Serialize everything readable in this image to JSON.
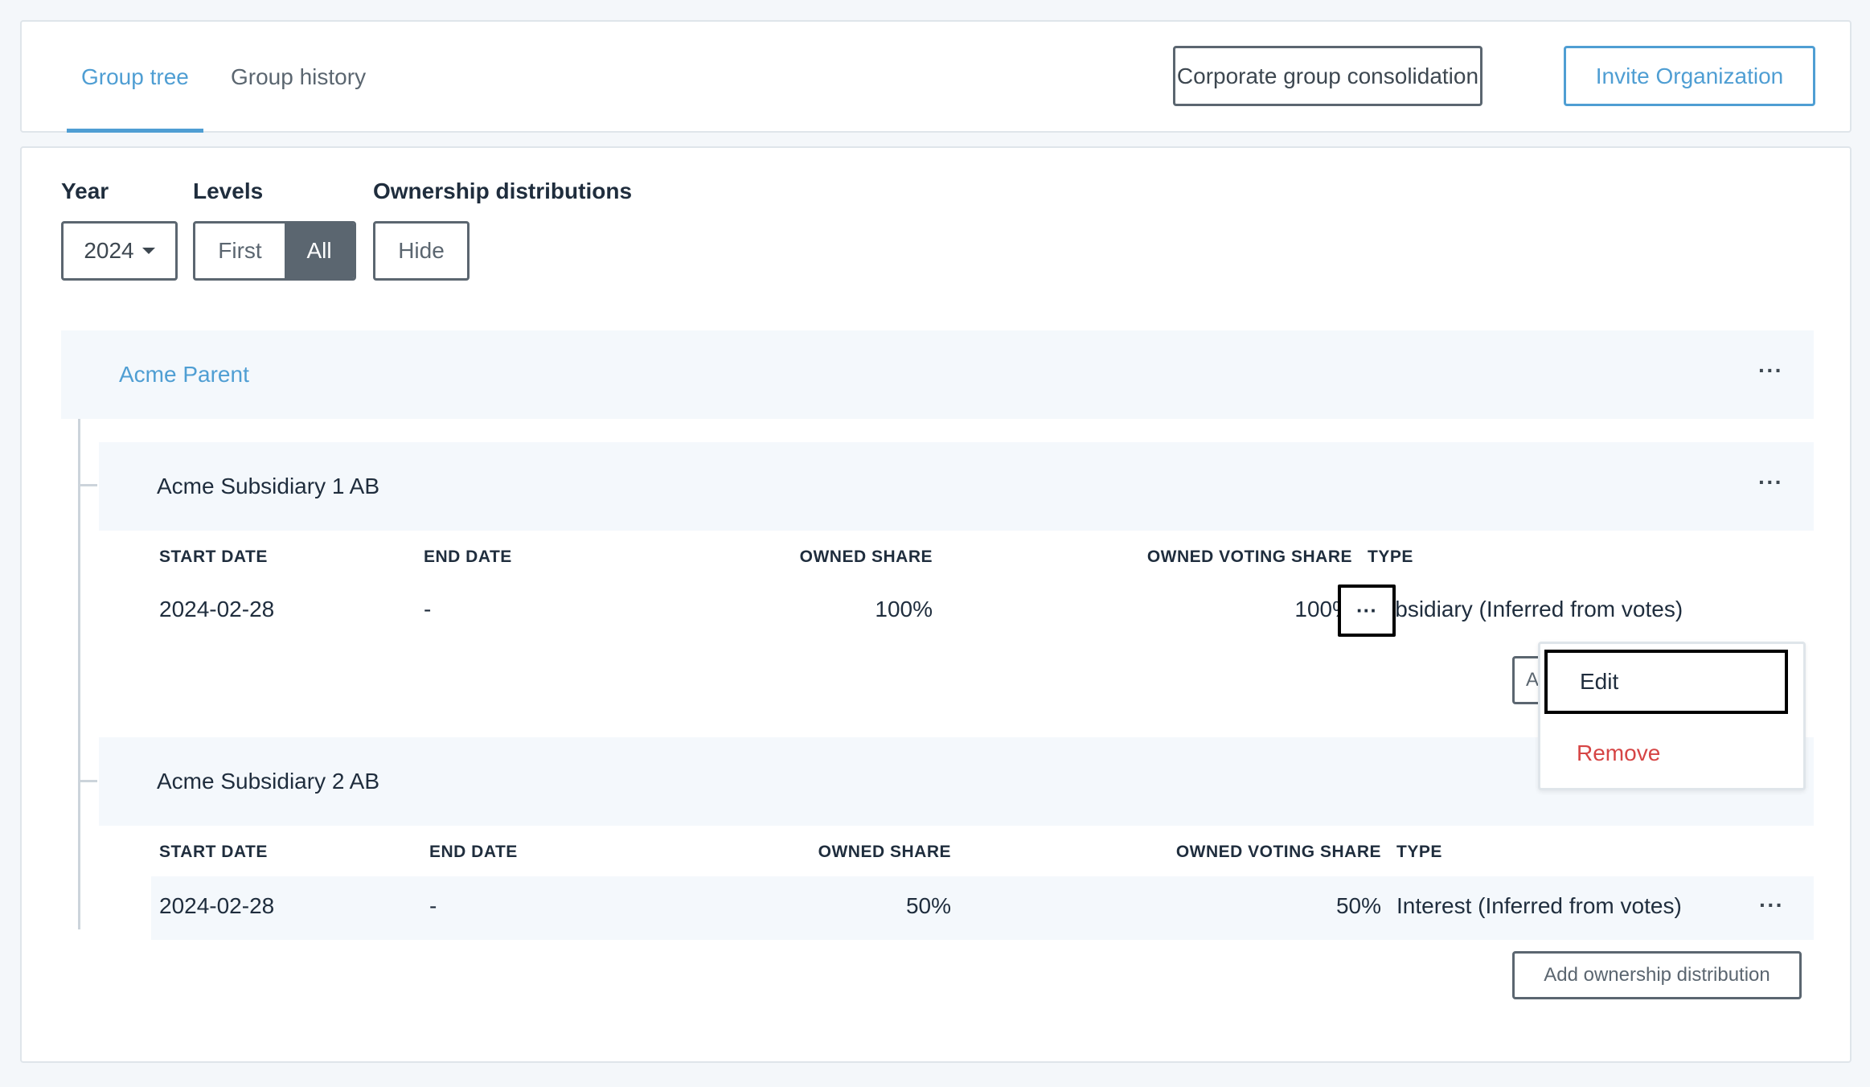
{
  "tabs": {
    "group_tree": "Group tree",
    "group_history": "Group history"
  },
  "header_buttons": {
    "consolidation": "Corporate group consolidation",
    "invite": "Invite Organization"
  },
  "filters": {
    "year_label": "Year",
    "year_value": "2024",
    "levels_label": "Levels",
    "levels_first": "First",
    "levels_all": "All",
    "levels_selected": "All",
    "ownership_label": "Ownership distributions",
    "ownership_toggle": "Hide"
  },
  "tree": {
    "parent": {
      "name": "Acme Parent",
      "menu": "···"
    },
    "columns": {
      "start": "START DATE",
      "end": "END DATE",
      "owned": "OWNED SHARE",
      "voting": "OWNED VOTING SHARE",
      "type": "TYPE"
    },
    "subsidiaries": [
      {
        "name": "Acme Subsidiary 1 AB",
        "menu": "···",
        "start": "2024-02-28",
        "end": "-",
        "owned": "100%",
        "voting": "100%",
        "type": "Subsidiary (Inferred from votes)",
        "row_menu": "···",
        "add_button": "Add ownership distribution",
        "add_button_visible": "A"
      },
      {
        "name": "Acme Subsidiary 2 AB",
        "start": "2024-02-28",
        "end": "-",
        "owned": "50%",
        "voting": "50%",
        "type": "Interest (Inferred from votes)",
        "row_menu": "···",
        "add_button": "Add ownership distribution"
      }
    ]
  },
  "context_menu": {
    "edit": "Edit",
    "remove": "Remove"
  },
  "colors": {
    "accent": "#4f9ed3",
    "dark": "#5b6670",
    "danger": "#d64545",
    "row_bg": "#f4f8fc"
  }
}
